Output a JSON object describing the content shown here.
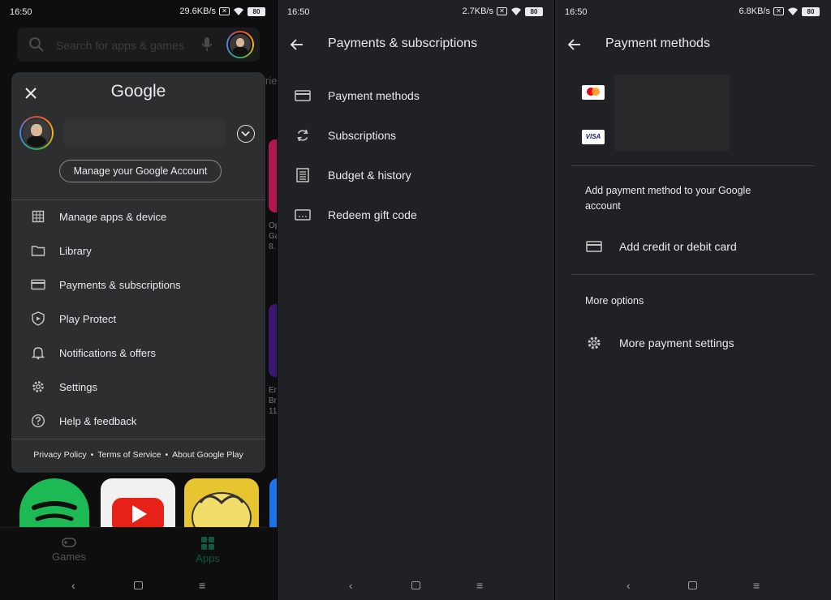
{
  "colors": {
    "background": "#202124",
    "drawer": "#2d2e30",
    "text": "#e8eaed",
    "accent_green": "#01875f"
  },
  "panel1": {
    "status": {
      "time": "16:50",
      "speed": "29.6KB/s",
      "battery": "80"
    },
    "search": {
      "placeholder": "Search for apps & games"
    },
    "bg_tab_fragment": "rie",
    "bg_card_text": [
      "Op",
      "Ga",
      "8."
    ],
    "bg_card_text2": [
      "En",
      "Br",
      "11"
    ],
    "drawer": {
      "brand": "Google",
      "manage_account": "Manage your Google Account",
      "items": [
        {
          "label": "Manage apps & device",
          "icon": "grid-icon"
        },
        {
          "label": "Library",
          "icon": "folder-icon"
        },
        {
          "label": "Payments & subscriptions",
          "icon": "card-icon"
        },
        {
          "label": "Play Protect",
          "icon": "shield-icon"
        },
        {
          "label": "Notifications & offers",
          "icon": "bell-icon"
        },
        {
          "label": "Settings",
          "icon": "gear-icon"
        },
        {
          "label": "Help & feedback",
          "icon": "help-icon"
        }
      ],
      "footer": {
        "privacy": "Privacy Policy",
        "terms": "Terms of Service",
        "about": "About Google Play"
      }
    },
    "bottom_nav": {
      "games": "Games",
      "apps": "Apps"
    }
  },
  "panel2": {
    "status": {
      "time": "16:50",
      "speed": "2.7KB/s",
      "battery": "80"
    },
    "title": "Payments & subscriptions",
    "items": [
      {
        "label": "Payment methods",
        "icon": "card-icon"
      },
      {
        "label": "Subscriptions",
        "icon": "refresh-icon"
      },
      {
        "label": "Budget & history",
        "icon": "list-icon"
      },
      {
        "label": "Redeem gift code",
        "icon": "gift-card-icon"
      }
    ]
  },
  "panel3": {
    "status": {
      "time": "16:50",
      "speed": "6.8KB/s",
      "battery": "80"
    },
    "title": "Payment methods",
    "visa_label": "VISA",
    "add_section": "Add payment method to your Google account",
    "add_card": "Add credit or debit card",
    "more_options": "More options",
    "more_settings": "More payment settings"
  }
}
